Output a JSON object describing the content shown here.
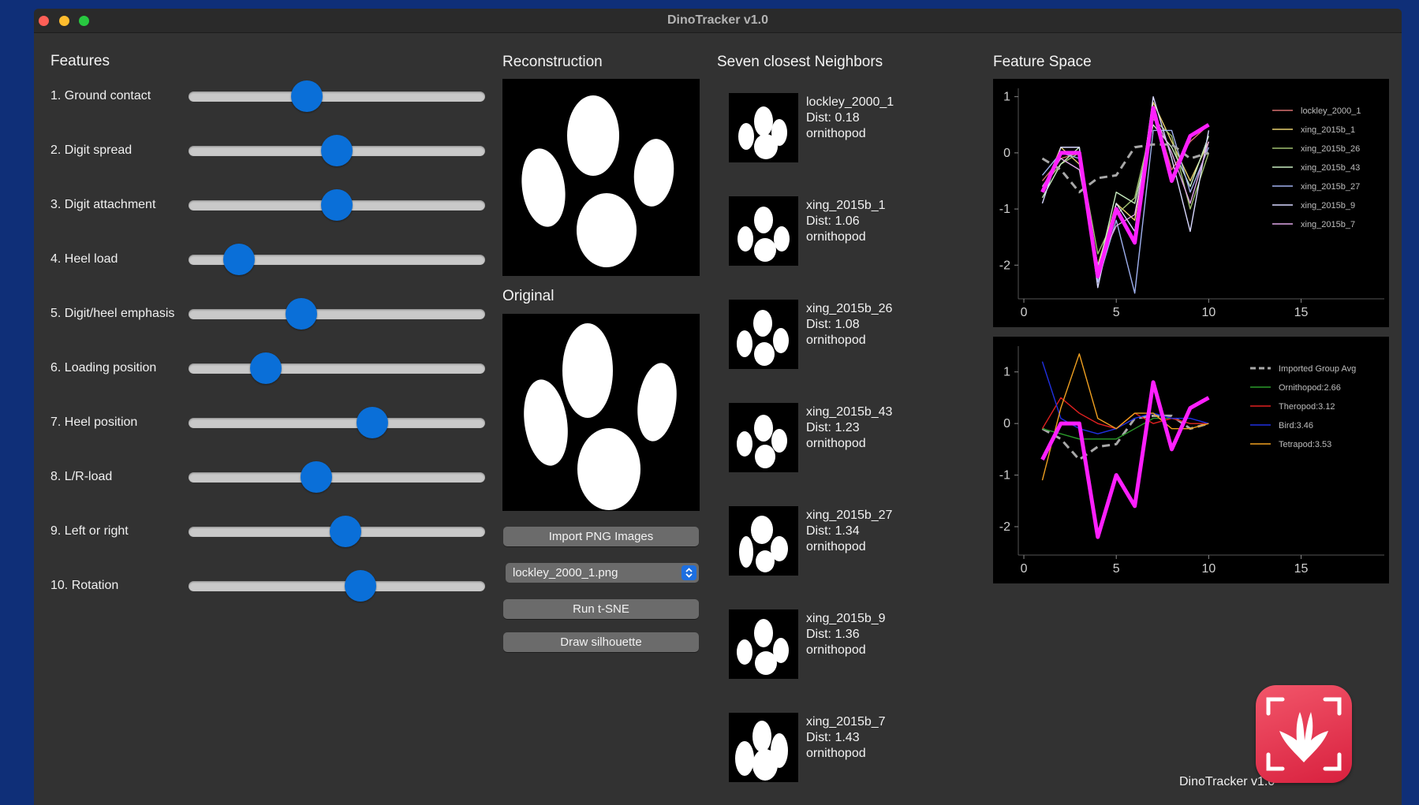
{
  "window": {
    "title": "DinoTracker v1.0"
  },
  "features": {
    "title": "Features",
    "sliders": [
      {
        "label": "1. Ground contact",
        "value": 0.4
      },
      {
        "label": "2. Digit spread",
        "value": 0.5
      },
      {
        "label": "3. Digit attachment",
        "value": 0.5
      },
      {
        "label": "4. Heel load",
        "value": 0.17
      },
      {
        "label": "5. Digit/heel emphasis",
        "value": 0.38
      },
      {
        "label": "6. Loading position",
        "value": 0.26
      },
      {
        "label": "7. Heel position",
        "value": 0.62
      },
      {
        "label": "8. L/R-load",
        "value": 0.43
      },
      {
        "label": "9. Left or right",
        "value": 0.53
      },
      {
        "label": "10. Rotation",
        "value": 0.58
      }
    ]
  },
  "reconstruction": {
    "title": "Reconstruction"
  },
  "original": {
    "title": "Original"
  },
  "controls": {
    "import_label": "Import PNG Images",
    "file_select": "lockley_2000_1.png",
    "tsne_label": "Run t-SNE",
    "silhouette_label": "Draw silhouette"
  },
  "neighbors": {
    "title": "Seven closest Neighbors",
    "items": [
      {
        "name": "lockley_2000_1",
        "dist": "Dist: 0.18",
        "group": "ornithopod"
      },
      {
        "name": "xing_2015b_1",
        "dist": "Dist: 1.06",
        "group": "ornithopod"
      },
      {
        "name": "xing_2015b_26",
        "dist": "Dist: 1.08",
        "group": "ornithopod"
      },
      {
        "name": "xing_2015b_43",
        "dist": "Dist: 1.23",
        "group": "ornithopod"
      },
      {
        "name": "xing_2015b_27",
        "dist": "Dist: 1.34",
        "group": "ornithopod"
      },
      {
        "name": "xing_2015b_9",
        "dist": "Dist: 1.36",
        "group": "ornithopod"
      },
      {
        "name": "xing_2015b_7",
        "dist": "Dist: 1.43",
        "group": "ornithopod"
      }
    ]
  },
  "feature_space": {
    "title": "Feature Space"
  },
  "chart_data": [
    {
      "type": "line",
      "xlim": [
        -0.3,
        19.5
      ],
      "ylim": [
        -2.6,
        1.15
      ],
      "xticks": [
        0,
        5,
        10,
        15
      ],
      "yticks": [
        1,
        0,
        -1,
        -2
      ],
      "legend_position": "top-right",
      "series": [
        {
          "name": "lockley_2000_1",
          "color": "#d87070",
          "x": [
            1,
            2,
            3,
            4,
            5,
            6,
            7,
            8,
            9,
            10
          ],
          "y": [
            -0.5,
            -0.1,
            0.0,
            -2.2,
            -1.0,
            -1.6,
            0.8,
            -0.3,
            0.2,
            0.5
          ]
        },
        {
          "name": "xing_2015b_1",
          "color": "#e8d070",
          "x": [
            1,
            2,
            3,
            4,
            5,
            6,
            7,
            8,
            9,
            10
          ],
          "y": [
            -0.7,
            0.1,
            -0.2,
            -2.0,
            -0.9,
            -1.2,
            0.9,
            0.2,
            -0.5,
            0.2
          ]
        },
        {
          "name": "xing_2015b_26",
          "color": "#a0c070",
          "x": [
            1,
            2,
            3,
            4,
            5,
            6,
            7,
            8,
            9,
            10
          ],
          "y": [
            -0.6,
            -0.2,
            0.0,
            -1.8,
            -1.1,
            -0.8,
            0.6,
            0.3,
            -1.0,
            0.0
          ]
        },
        {
          "name": "xing_2015b_43",
          "color": "#c8ecc0",
          "x": [
            1,
            2,
            3,
            4,
            5,
            6,
            7,
            8,
            9,
            10
          ],
          "y": [
            -0.8,
            -0.2,
            0.1,
            -2.1,
            -0.7,
            -0.9,
            0.5,
            0.1,
            -0.6,
            0.3
          ]
        },
        {
          "name": "xing_2015b_27",
          "color": "#9fb0ee",
          "x": [
            1,
            2,
            3,
            4,
            5,
            6,
            7,
            8,
            9,
            10
          ],
          "y": [
            -0.4,
            0.0,
            -0.1,
            -2.3,
            -1.2,
            -2.5,
            0.4,
            0.4,
            -0.7,
            0.1
          ]
        },
        {
          "name": "xing_2015b_9",
          "color": "#d8d8ff",
          "x": [
            1,
            2,
            3,
            4,
            5,
            6,
            7,
            8,
            9,
            10
          ],
          "y": [
            -0.9,
            0.1,
            0.1,
            -2.4,
            -0.9,
            -1.4,
            1.0,
            -0.1,
            -1.4,
            0.4
          ]
        },
        {
          "name": "xing_2015b_7",
          "color": "#e0a8e8",
          "x": [
            1,
            2,
            3,
            4,
            5,
            6,
            7,
            8,
            9,
            10
          ],
          "y": [
            -0.6,
            -0.1,
            -0.3,
            -2.0,
            -1.3,
            -1.1,
            0.7,
            0.0,
            -0.9,
            0.2
          ]
        },
        {
          "name": "",
          "color": "#a8a8a8",
          "dashed": true,
          "width": 3,
          "x": [
            1,
            2,
            3,
            4,
            5,
            6,
            7,
            8,
            9,
            10
          ],
          "y": [
            -0.1,
            -0.3,
            -0.7,
            -0.45,
            -0.4,
            0.1,
            0.15,
            0.15,
            -0.1,
            0.0
          ]
        },
        {
          "name": "",
          "color": "#ff1fff",
          "width": 5,
          "x": [
            1,
            2,
            3,
            4,
            5,
            6,
            7,
            8,
            9,
            10
          ],
          "y": [
            -0.7,
            0.0,
            0.0,
            -2.2,
            -1.0,
            -1.6,
            0.8,
            -0.5,
            0.3,
            0.5
          ]
        }
      ]
    },
    {
      "type": "line",
      "xlim": [
        -0.3,
        19.5
      ],
      "ylim": [
        -2.55,
        1.5
      ],
      "xticks": [
        0,
        5,
        10,
        15
      ],
      "yticks": [
        1,
        0,
        -1,
        -2
      ],
      "legend_position": "top-right",
      "series": [
        {
          "name": "Imported Group Avg",
          "color": "#a8a8a8",
          "dashed": true,
          "width": 3,
          "x": [
            1,
            2,
            3,
            4,
            5,
            6,
            7,
            8,
            9,
            10
          ],
          "y": [
            -0.1,
            -0.3,
            -0.7,
            -0.45,
            -0.4,
            0.1,
            0.15,
            0.15,
            -0.1,
            0.0
          ]
        },
        {
          "name": "Ornithopod:2.66",
          "color": "#2a9a2a",
          "x": [
            1,
            2,
            3,
            4,
            5,
            6,
            7,
            8,
            9,
            10
          ],
          "y": [
            -0.1,
            -0.2,
            -0.3,
            -0.3,
            -0.3,
            -0.1,
            0.1,
            0.1,
            0.0,
            0.0
          ]
        },
        {
          "name": "Theropod:3.12",
          "color": "#e02020",
          "x": [
            1,
            2,
            3,
            4,
            5,
            6,
            7,
            8,
            9,
            10
          ],
          "y": [
            -0.1,
            0.5,
            0.2,
            0.0,
            -0.1,
            0.2,
            0.0,
            0.1,
            0.0,
            0.0
          ]
        },
        {
          "name": "Bird:3.46",
          "color": "#2030e0",
          "x": [
            1,
            2,
            3,
            4,
            5,
            6,
            7,
            8,
            9,
            10
          ],
          "y": [
            1.2,
            0.1,
            -0.1,
            -0.2,
            -0.1,
            0.1,
            0.2,
            0.1,
            0.1,
            0.0
          ]
        },
        {
          "name": "Tetrapod:3.53",
          "color": "#f0a020",
          "x": [
            1,
            2,
            3,
            4,
            5,
            6,
            7,
            8,
            9,
            10
          ],
          "y": [
            -1.1,
            0.3,
            1.35,
            0.1,
            -0.1,
            0.2,
            0.2,
            -0.1,
            -0.1,
            0.0
          ]
        },
        {
          "name": "",
          "color": "#ff1fff",
          "width": 5,
          "x": [
            1,
            2,
            3,
            4,
            5,
            6,
            7,
            8,
            9,
            10
          ],
          "y": [
            -0.7,
            0.0,
            0.0,
            -2.2,
            -1.0,
            -1.6,
            0.8,
            -0.5,
            0.3,
            0.5
          ]
        }
      ]
    }
  ],
  "footer": {
    "label": "DinoTracker v1.0"
  },
  "colors": {
    "accent": "#0a6fd8",
    "window_bg": "#323232",
    "desktop_bg": "#0f2f78",
    "highlight": "#ff1fff"
  }
}
